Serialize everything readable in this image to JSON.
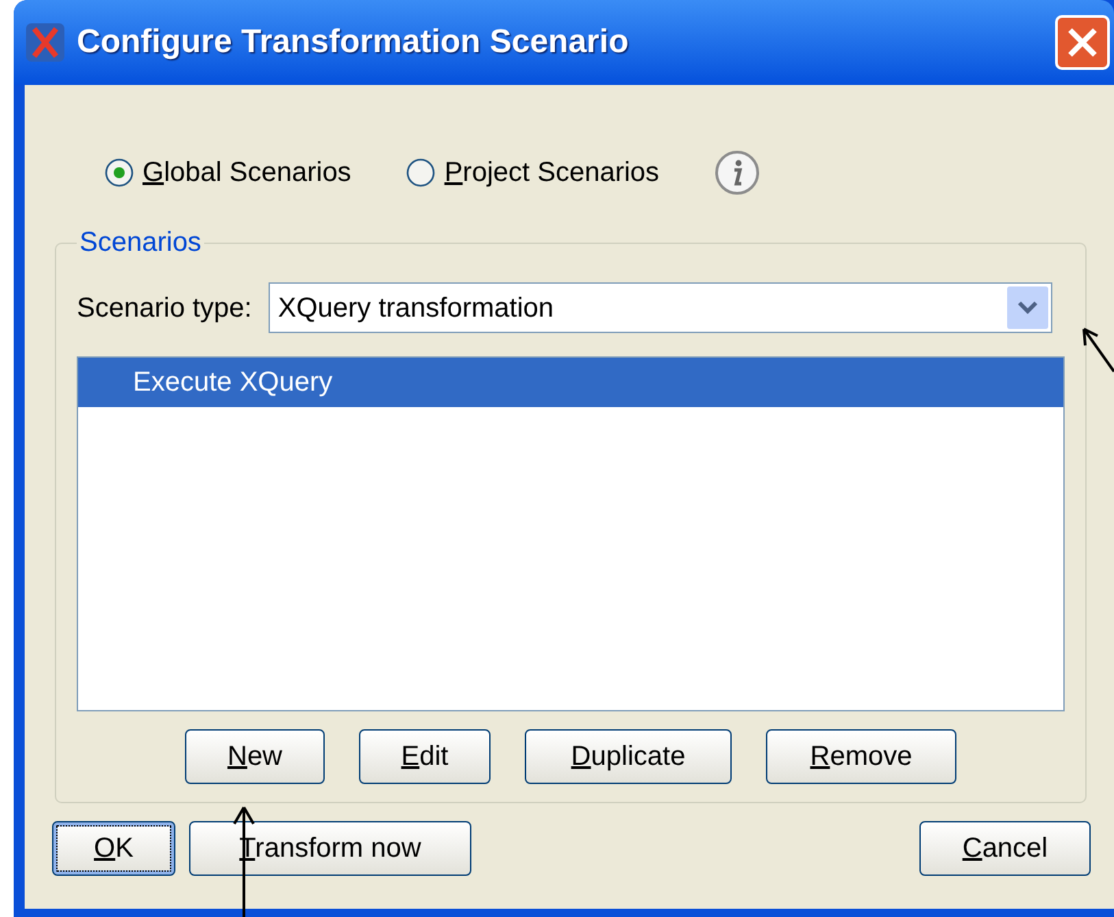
{
  "window": {
    "title": "Configure Transformation Scenario"
  },
  "scope_options": [
    {
      "label": "Global Scenarios",
      "mnemonic": true,
      "selected": true
    },
    {
      "label": "Project Scenarios",
      "mnemonic": true,
      "selected": false
    }
  ],
  "scenarios_group": {
    "title": "Scenarios",
    "type_label": "Scenario type:",
    "type_value": "XQuery transformation",
    "list": [
      {
        "label": "Execute XQuery",
        "selected": true
      }
    ],
    "buttons": [
      {
        "label": "New",
        "mnemonic": true
      },
      {
        "label": "Edit",
        "mnemonic": true
      },
      {
        "label": "Duplicate",
        "mnemonic": true
      },
      {
        "label": "Remove",
        "mnemonic": true
      }
    ]
  },
  "footer_buttons": [
    {
      "label": "OK",
      "mnemonic": true,
      "focused": true
    },
    {
      "label": "Transform now",
      "mnemonic": true,
      "focused": false
    },
    {
      "label": "Cancel",
      "mnemonic": true,
      "focused": false
    }
  ]
}
